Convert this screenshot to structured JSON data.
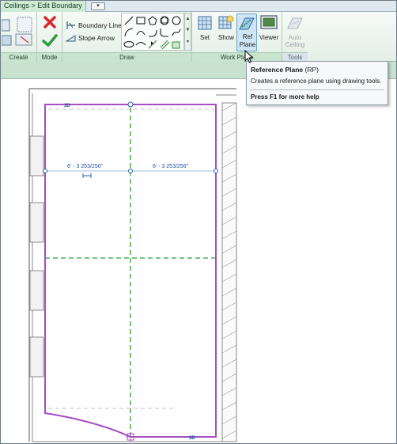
{
  "tabs": {
    "context_tab": "Ceilings > Edit Boundary",
    "dropdown_glyph": "▾"
  },
  "ribbon": {
    "panels": {
      "create": "Create",
      "mode": "Mode",
      "draw": "Draw",
      "work_plane": "Work Plane",
      "tools": "Tools"
    },
    "draw": {
      "boundary_line": "Boundary Line",
      "slope_arrow": "Slope Arrow"
    },
    "work_plane": {
      "set": "Set",
      "show": "Show",
      "ref_plane_line1": "Ref",
      "ref_plane_line2": "Plane",
      "viewer": "Viewer"
    },
    "tools": {
      "auto_ceiling_line1": "Auto",
      "auto_ceiling_line2": "Ceiling"
    }
  },
  "tooltip": {
    "title": "Reference Plane",
    "shortcut": "(RP)",
    "description": "Creates a reference plane using drawing tools.",
    "help": "Press F1 for more help"
  },
  "canvas": {
    "dimension_left": "6' - 3 253/256\"",
    "dimension_right": "6' - 3 253/256\"",
    "marker_3d": "3D"
  },
  "colors": {
    "sketch_magenta": "#a64dc1",
    "reference_green": "#2e9e3a",
    "dimension_blue": "#1f4fa3",
    "wall_gray": "#8a8a8a"
  },
  "icons": [
    "modify-icon",
    "finish-edit-check-icon",
    "cancel-edit-x-icon",
    "boundary-line-icon",
    "slope-arrow-icon",
    "set-workplane-icon",
    "show-workplane-icon",
    "ref-plane-icon",
    "viewer-icon",
    "auto-ceiling-icon",
    "cursor-arrow-icon"
  ]
}
